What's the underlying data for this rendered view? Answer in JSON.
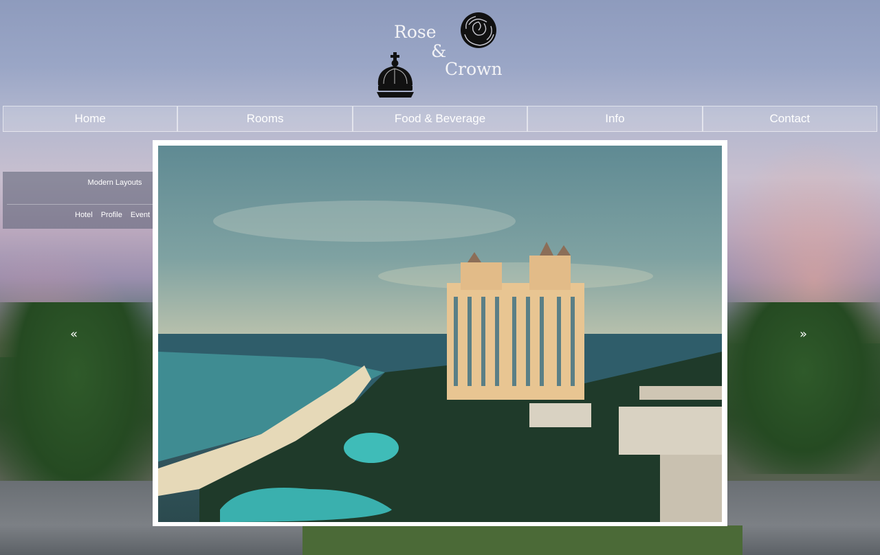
{
  "logo": {
    "word1": "Rose",
    "ampersand": "&",
    "word2": "Crown",
    "rose_icon": "rose-icon",
    "crown_icon": "crown-icon"
  },
  "nav": {
    "items": [
      {
        "label": "Home"
      },
      {
        "label": "Rooms"
      },
      {
        "label": "Food & Beverage"
      },
      {
        "label": "Info"
      },
      {
        "label": "Contact"
      }
    ]
  },
  "layouts_panel": {
    "title": "Modern Layouts",
    "links": [
      "Hotel",
      "Profile",
      "Event"
    ]
  },
  "carousel": {
    "prev_icon": "double-chevron-left-icon",
    "prev_glyph": "«",
    "next_icon": "double-chevron-right-icon",
    "next_glyph": "»",
    "image": "resort-hotel-beach-photo"
  },
  "colors": {
    "nav_text": "#ffffff",
    "frame": "#ffffff"
  }
}
